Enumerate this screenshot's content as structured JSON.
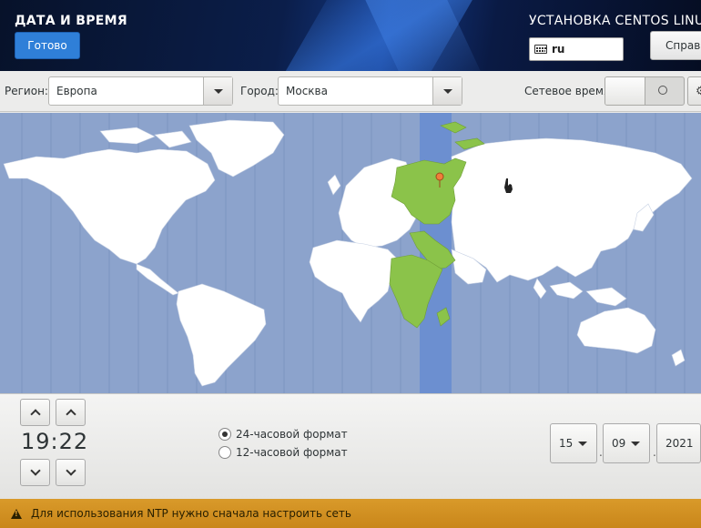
{
  "header": {
    "page_title": "ДАТА И ВРЕМЯ",
    "done_label": "Готово",
    "install_title": "УСТАНОВКА CENTOS LINU",
    "keyboard_layout": "ru",
    "help_label": "Справ"
  },
  "region_bar": {
    "region_label": "Регион:",
    "region_value": "Европа",
    "city_label": "Город:",
    "city_value": "Москва",
    "network_time_label": "Сетевое время",
    "network_time_enabled": false
  },
  "map": {
    "selected_city": "Москва",
    "timezone_highlight": "UTC+3"
  },
  "time": {
    "value": "19:22",
    "format_24_label": "24-часовой формат",
    "format_12_label": "12-часовой формат",
    "selected_format": "24"
  },
  "date": {
    "day": "15",
    "month": "09",
    "year": "2021",
    "separator": "."
  },
  "warning": {
    "message": "Для использования NTP нужно сначала настроить сеть"
  },
  "colors": {
    "header_bg": "#0b1e4a",
    "done_button": "#2f7fd8",
    "ocean": "#8ca3cc",
    "land": "#ffffff",
    "timezone_land": "#8bc34a",
    "timezone_band": "#6c8fd0",
    "warning_bar": "#d4921f"
  }
}
